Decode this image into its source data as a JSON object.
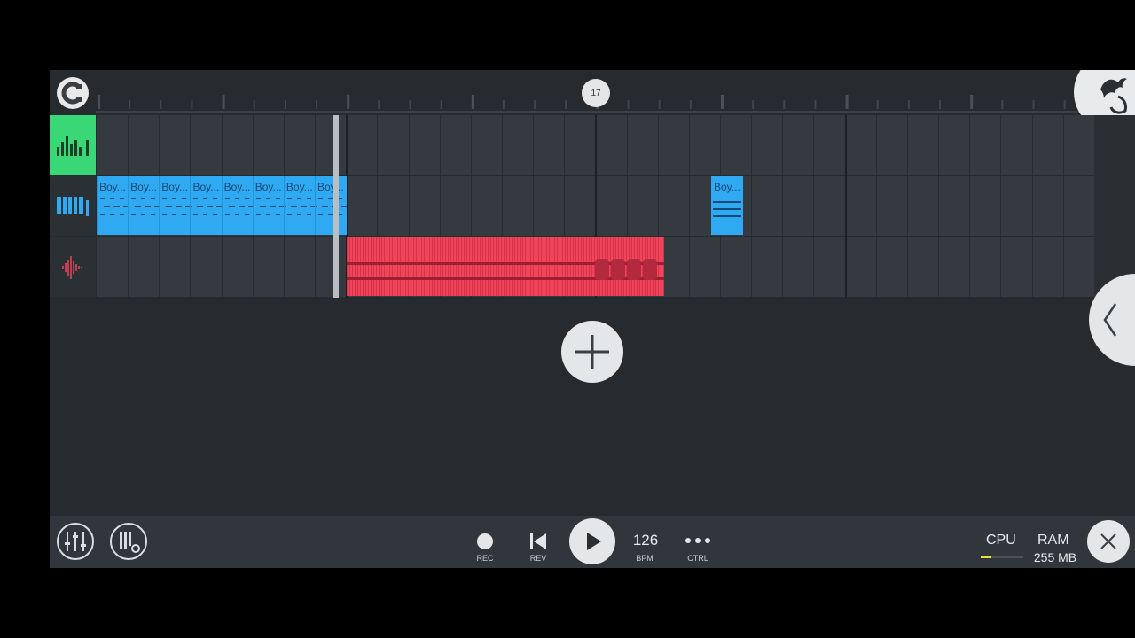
{
  "ruler": {
    "marker_number": "17"
  },
  "tracks": [
    {
      "name": "mixer-track",
      "color": "#3ad776"
    },
    {
      "name": "piano-roll-track",
      "color": "#2fa9f2"
    },
    {
      "name": "audio-track",
      "color": "#f0445a"
    }
  ],
  "clips": {
    "pattern_label": "Boy...",
    "pattern_count_first_block": 8
  },
  "toolbar": {
    "rec_label": "REC",
    "rev_label": "REV",
    "bpm_value": "126",
    "bpm_label": "BPM",
    "ctrl_label": "CTRL",
    "cpu_label": "CPU",
    "ram_label": "RAM",
    "ram_value": "255 MB",
    "cpu_usage": 0.25
  },
  "colors": {
    "accent_green": "#3ad776",
    "clip_blue": "#2fa9f2",
    "clip_red": "#f0445a",
    "cpu_meter": "#e6e13a"
  },
  "icons": [
    "magnet-snap-icon",
    "fl-fruit-logo-icon",
    "mixer-bars-icon",
    "piano-keys-icon",
    "waveform-icon",
    "plus-icon",
    "chevron-left-icon",
    "mixer-sliders-icon",
    "piano-settings-icon",
    "record-dot-icon",
    "rewind-icon",
    "play-icon",
    "more-dots-icon",
    "close-x-icon"
  ]
}
